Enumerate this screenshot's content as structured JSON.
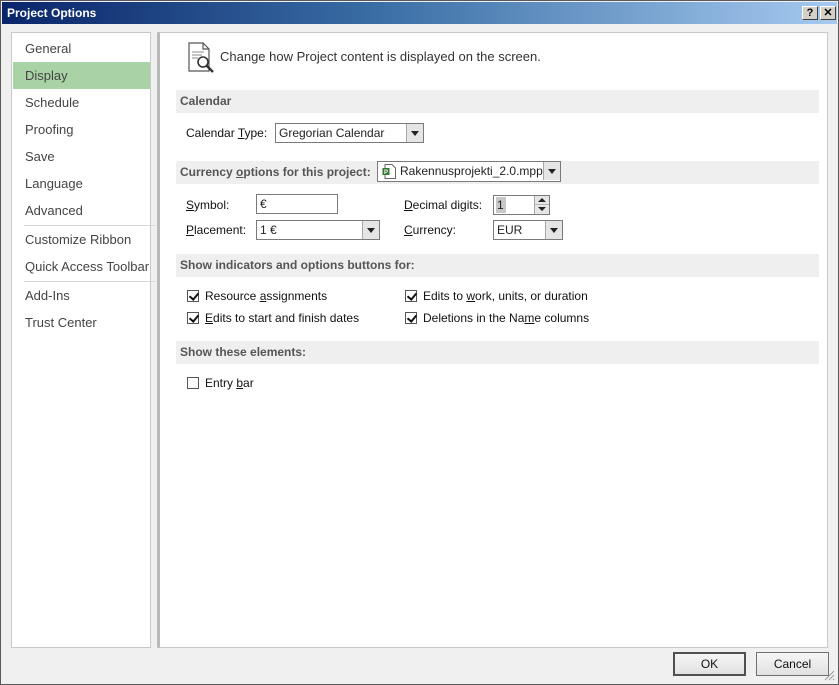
{
  "window": {
    "title": "Project Options",
    "help": "?",
    "close": "✕"
  },
  "sidebar": {
    "items": [
      {
        "label": "General"
      },
      {
        "label": "Display"
      },
      {
        "label": "Schedule"
      },
      {
        "label": "Proofing"
      },
      {
        "label": "Save"
      },
      {
        "label": "Language"
      },
      {
        "label": "Advanced"
      },
      {
        "label": "Customize Ribbon"
      },
      {
        "label": "Quick Access Toolbar"
      },
      {
        "label": "Add-Ins"
      },
      {
        "label": "Trust Center"
      }
    ],
    "active": "Display",
    "active_color": "#a9d3a6"
  },
  "main": {
    "header": {
      "text": "Change how Project content is displayed on the screen.",
      "icon": "document-magnifier-icon"
    },
    "calendar": {
      "section_title": "Calendar",
      "type_label_pre": "Calendar ",
      "type_label_key": "T",
      "type_label_post": "ype:",
      "type_value": "Gregorian Calendar"
    },
    "currency": {
      "section_pre": "Currency ",
      "section_key": "o",
      "section_post": "ptions for this project:",
      "project_value": "Rakennusprojekti_2.0.mpp",
      "symbol_key": "S",
      "symbol_post": "ymbol:",
      "symbol_value": "€",
      "placement_key": "P",
      "placement_post": "lacement:",
      "placement_value": "1 €",
      "decimal_key": "D",
      "decimal_post": "ecimal digits:",
      "decimal_value": "1",
      "currency_key": "C",
      "currency_post": "urrency:",
      "currency_value": "EUR"
    },
    "indicators": {
      "section_title": "Show indicators and options buttons for:",
      "items": [
        {
          "pre": "Resource ",
          "key": "a",
          "post": "ssignments",
          "checked": true
        },
        {
          "pre": "",
          "key": "E",
          "post": "dits to start and finish dates",
          "checked": true
        },
        {
          "pre": "Edits to ",
          "key": "w",
          "post": "ork, units, or duration",
          "checked": true
        },
        {
          "pre": "Deletions in the Na",
          "key": "m",
          "post": "e columns",
          "checked": true
        }
      ]
    },
    "elements": {
      "section_title": "Show these elements:",
      "entry_bar_pre": "Entry ",
      "entry_bar_key": "b",
      "entry_bar_post": "ar",
      "entry_bar_checked": false
    }
  },
  "buttons": {
    "ok": "OK",
    "cancel": "Cancel"
  }
}
